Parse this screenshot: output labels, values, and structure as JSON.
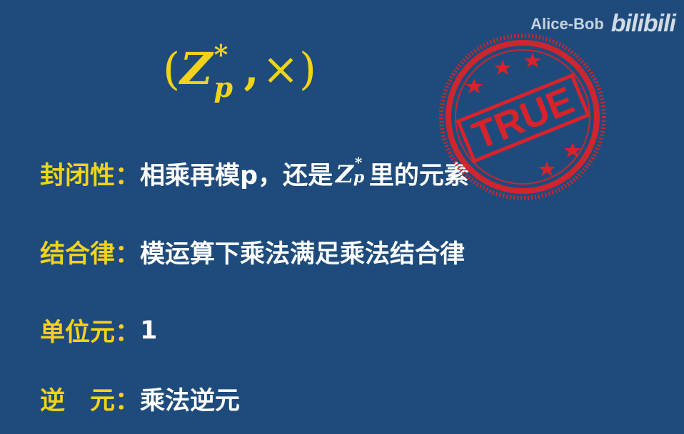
{
  "watermark": {
    "author": "Alice-Bob",
    "logo": "bilibili"
  },
  "title": {
    "open": "(",
    "base": "Z",
    "superscript": "*",
    "subscript": "p",
    "comma": ",",
    "op": "×",
    "close": ")"
  },
  "rows": [
    {
      "label": "封闭性：",
      "text_before": "相乘再模p，还是",
      "math_base": "Z",
      "math_sup": "*",
      "math_sub": "p",
      "text_after": "里的元素"
    },
    {
      "label": "结合律：",
      "text": "模运算下乘法满足乘法结合律"
    },
    {
      "label": "单位元：",
      "text": "1"
    },
    {
      "label": "逆　元：",
      "text": "乘法逆元"
    }
  ],
  "stamp": {
    "text": "TRUE",
    "color": "#d8232a"
  },
  "colors": {
    "background": "#1e4b7c",
    "label": "#f2d21a",
    "body_text": "#ffffff"
  }
}
